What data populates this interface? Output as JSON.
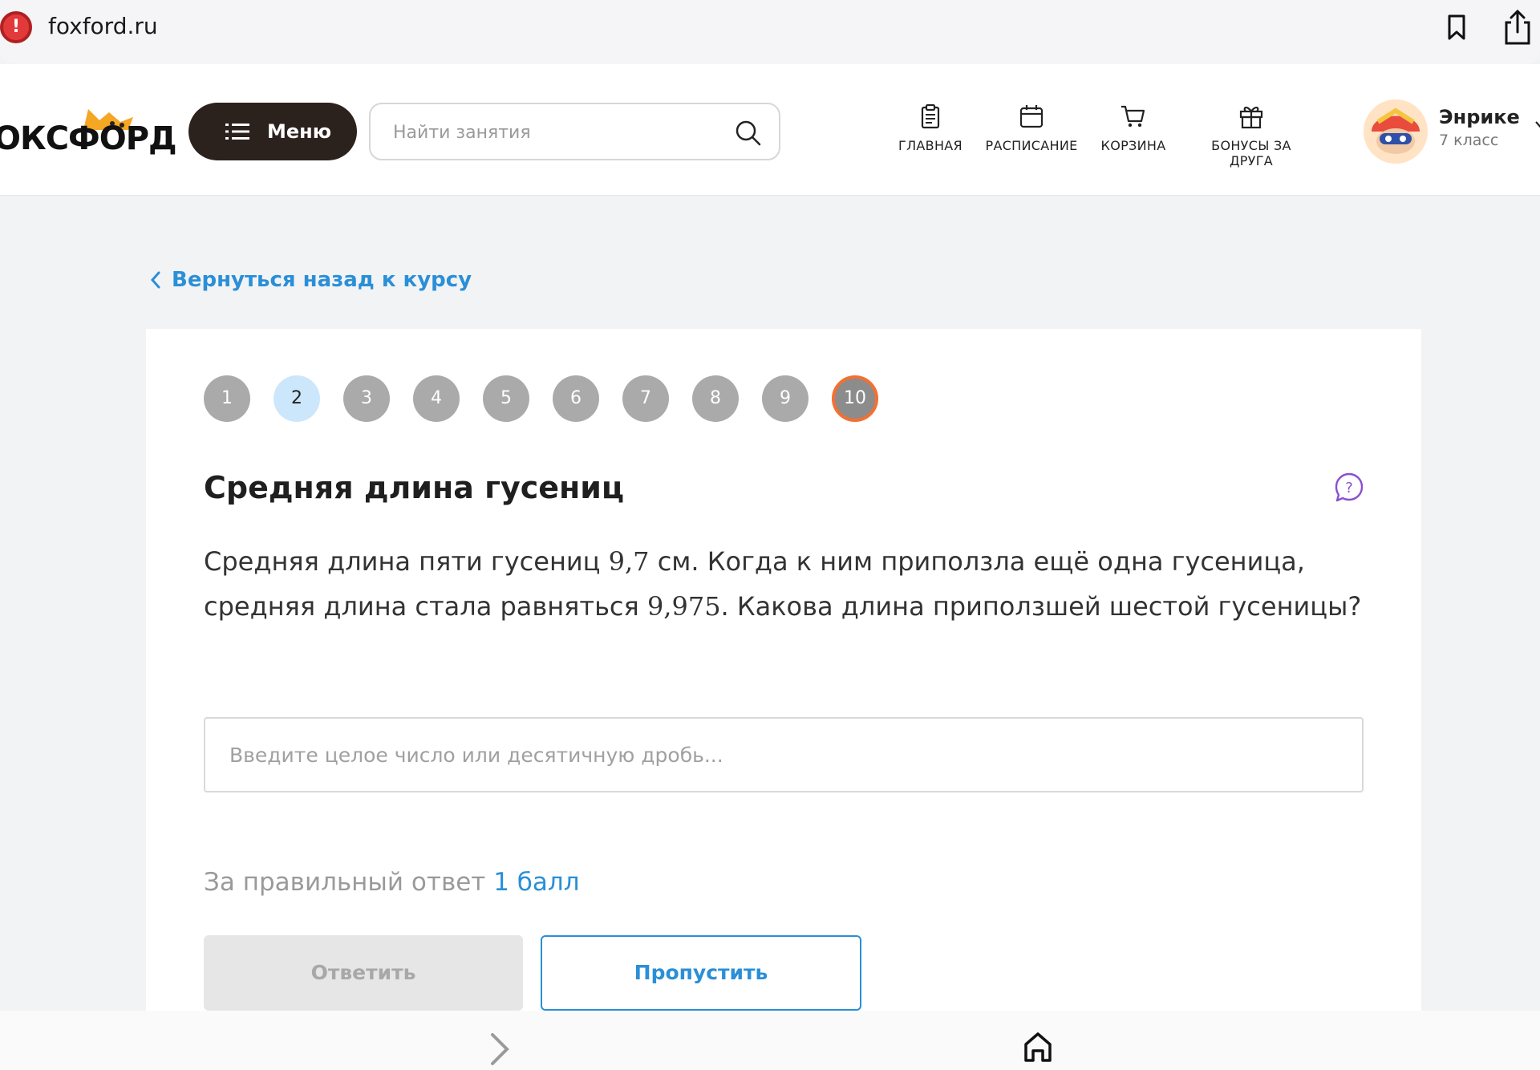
{
  "browser": {
    "url": "foxford.ru",
    "icons": [
      "site-warning-icon",
      "bookmark-icon",
      "share-icon",
      "forward-icon",
      "home-icon"
    ]
  },
  "header": {
    "logo_text": "ОКСФОРД",
    "menu_label": "Меню",
    "search_placeholder": "Найти занятия",
    "nav": [
      {
        "label": "ГЛАВНАЯ",
        "icon": "clipboard-icon"
      },
      {
        "label": "РАСПИСАНИЕ",
        "icon": "calendar-icon"
      },
      {
        "label": "КОРЗИНА",
        "icon": "cart-icon"
      },
      {
        "label": "БОНУСЫ ЗА ДРУГА",
        "icon": "gift-icon"
      }
    ],
    "profile": {
      "name": "Энрике",
      "grade": "7 класс"
    }
  },
  "back_link": "Вернуться назад к курсу",
  "steps": [
    "1",
    "2",
    "3",
    "4",
    "5",
    "6",
    "7",
    "8",
    "9",
    "10"
  ],
  "current_step": "2",
  "task": {
    "title": "Средняя длина гусениц",
    "text_parts": {
      "p1": "Средняя длина пяти гусениц ",
      "n1": "9,7",
      "p2": " см. Когда к ним приползла ещё одна гусеница, средняя длина стала равняться ",
      "n2": "9,975",
      "p3": ". Какова длина приползшей шестой гусеницы?"
    },
    "answer_placeholder": "Введите целое число или десятичную дробь...",
    "score_prefix": "За правильный ответ",
    "score_value": "1 балл",
    "submit_label": "Ответить",
    "skip_label": "Пропустить"
  },
  "colors": {
    "accent_blue": "#2a8fd7",
    "menu_dark": "#2b211d",
    "active_step_border": "#f37032",
    "current_step_bg": "#cce7fb"
  }
}
